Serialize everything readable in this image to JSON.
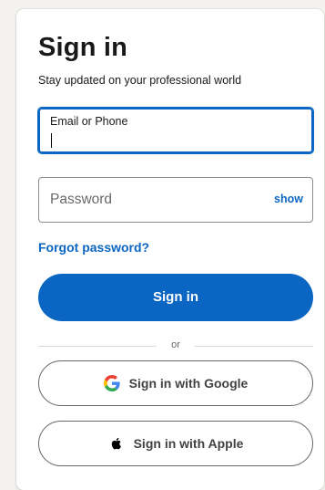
{
  "signin": {
    "title": "Sign in",
    "subtitle": "Stay updated on your professional world",
    "email": {
      "label": "Email or Phone",
      "value": ""
    },
    "password": {
      "placeholder": "Password",
      "show_label": "show"
    },
    "forgot_label": "Forgot password?",
    "submit_label": "Sign in",
    "divider_text": "or",
    "google_label": "Sign in with Google",
    "apple_label": "Sign in with Apple"
  },
  "colors": {
    "brand": "#0a66c2",
    "background": "#f3f2ef",
    "card": "#ffffff"
  },
  "icons": {
    "google": "google-icon",
    "apple": "apple-icon"
  }
}
